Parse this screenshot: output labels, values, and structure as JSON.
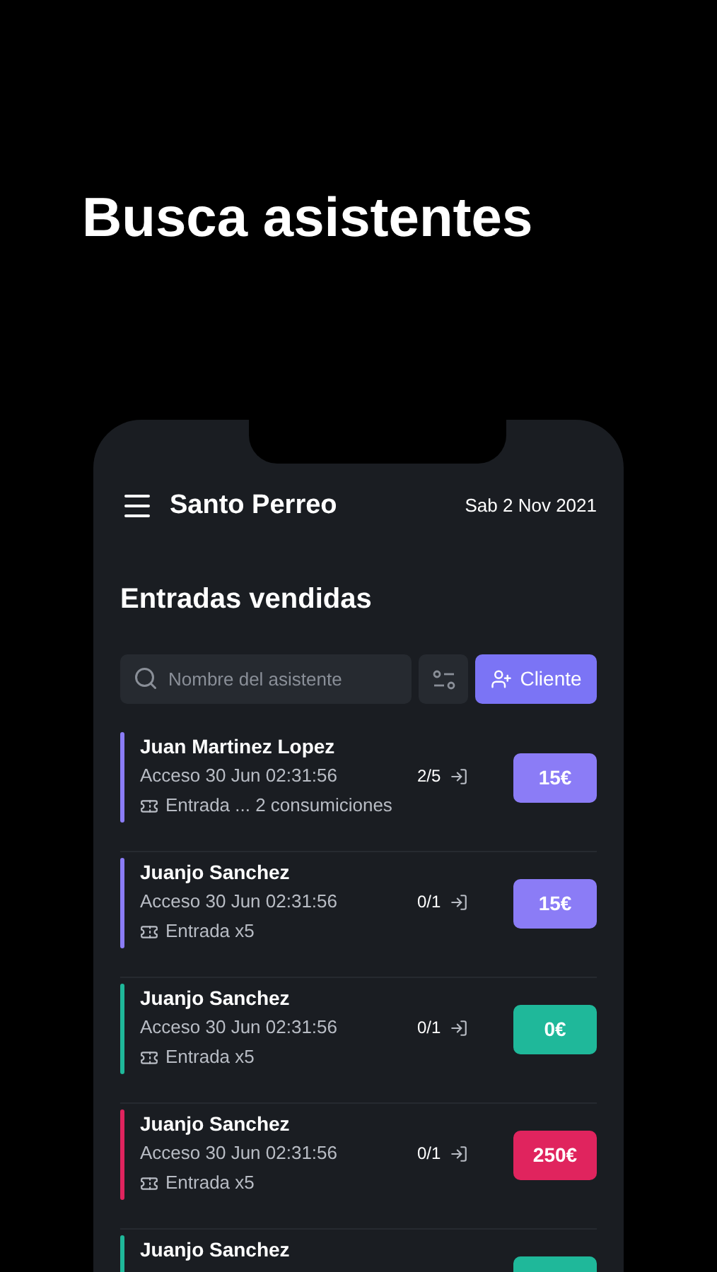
{
  "headline": "Busca asistentes",
  "app_bar": {
    "title": "Santo Perreo",
    "date": "Sab 2 Nov 2021"
  },
  "section_title": "Entradas vendidas",
  "search": {
    "placeholder": "Nombre del asistente"
  },
  "add_button": {
    "label": "Cliente"
  },
  "tickets": [
    {
      "name": "Juan Martinez Lopez",
      "access": "Acceso 30 Jun 02:31:56",
      "count": "2/5",
      "ticket": "Entrada ... 2 consumiciones",
      "price": "15€",
      "color": "#8b7cf6"
    },
    {
      "name": "Juanjo Sanchez",
      "access": "Acceso 30 Jun 02:31:56",
      "count": "0/1",
      "ticket": "Entrada x5",
      "price": "15€",
      "color": "#8b7cf6"
    },
    {
      "name": "Juanjo Sanchez",
      "access": "Acceso 30 Jun 02:31:56",
      "count": "0/1",
      "ticket": "Entrada x5",
      "price": "0€",
      "color": "#1fb89a"
    },
    {
      "name": "Juanjo Sanchez",
      "access": "Acceso 30 Jun 02:31:56",
      "count": "0/1",
      "ticket": "Entrada x5",
      "price": "250€",
      "color": "#e0245e"
    },
    {
      "name": "Juanjo Sanchez",
      "color": "#1fb89a"
    }
  ]
}
